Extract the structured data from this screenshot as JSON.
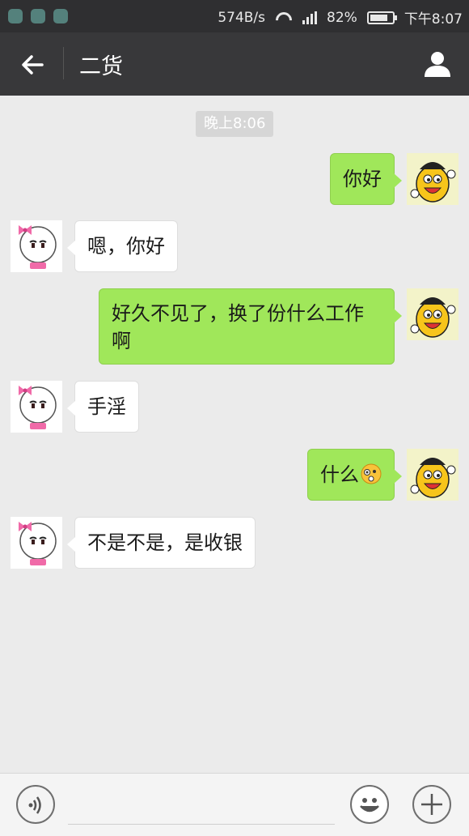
{
  "status_bar": {
    "speed": "574B/s",
    "battery": "82%",
    "battery_level": 0.82,
    "time": "下午8:07"
  },
  "header": {
    "title": "二货"
  },
  "conversation": {
    "timestamp": "晚上8:06",
    "messages": [
      {
        "from": "me",
        "lines": [
          "你好"
        ]
      },
      {
        "from": "them",
        "lines": [
          "嗯，你好"
        ]
      },
      {
        "from": "me",
        "lines": [
          "好久不见了，换了份什么工作",
          "啊"
        ]
      },
      {
        "from": "them",
        "lines": [
          "手淫"
        ]
      },
      {
        "from": "me",
        "lines": [
          "什么"
        ],
        "emoji": "confused-emoji"
      },
      {
        "from": "them",
        "lines": [
          "不是不是，是收银"
        ]
      }
    ]
  },
  "colors": {
    "me_bubble": "#a0e75a",
    "them_bubble": "#ffffff",
    "header": "#38383a",
    "status_bar": "#2f2f31"
  },
  "icons": [
    "back-arrow-icon",
    "profile-icon",
    "voice-icon",
    "emoji-icon",
    "plus-icon"
  ]
}
